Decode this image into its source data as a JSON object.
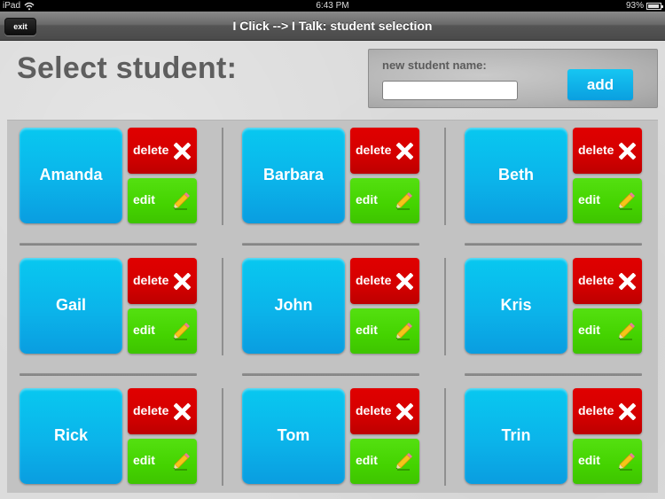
{
  "statusbar": {
    "device": "iPad",
    "time": "6:43 PM",
    "battery": "93%"
  },
  "navbar": {
    "exit_label": "exit",
    "title": "I Click --> I Talk: student selection"
  },
  "page": {
    "title": "Select student:"
  },
  "add_student": {
    "label": "new student name:",
    "input_value": "",
    "input_placeholder": "",
    "add_label": "add"
  },
  "students": [
    {
      "name": "Amanda",
      "delete_label": "delete",
      "edit_label": "edit"
    },
    {
      "name": "Barbara",
      "delete_label": "delete",
      "edit_label": "edit"
    },
    {
      "name": "Beth",
      "delete_label": "delete",
      "edit_label": "edit"
    },
    {
      "name": "Gail",
      "delete_label": "delete",
      "edit_label": "edit"
    },
    {
      "name": "John",
      "delete_label": "delete",
      "edit_label": "edit"
    },
    {
      "name": "Kris",
      "delete_label": "delete",
      "edit_label": "edit"
    },
    {
      "name": "Rick",
      "delete_label": "delete",
      "edit_label": "edit"
    },
    {
      "name": "Tom",
      "delete_label": "delete",
      "edit_label": "edit"
    },
    {
      "name": "Trin",
      "delete_label": "delete",
      "edit_label": "edit"
    }
  ],
  "icons": {
    "delete": "close-x-icon",
    "edit": "pencil-icon"
  },
  "colors": {
    "name_button": "#0bb4ea",
    "delete_button": "#d40000",
    "edit_button": "#44d300",
    "add_button": "#0fb2ea"
  }
}
